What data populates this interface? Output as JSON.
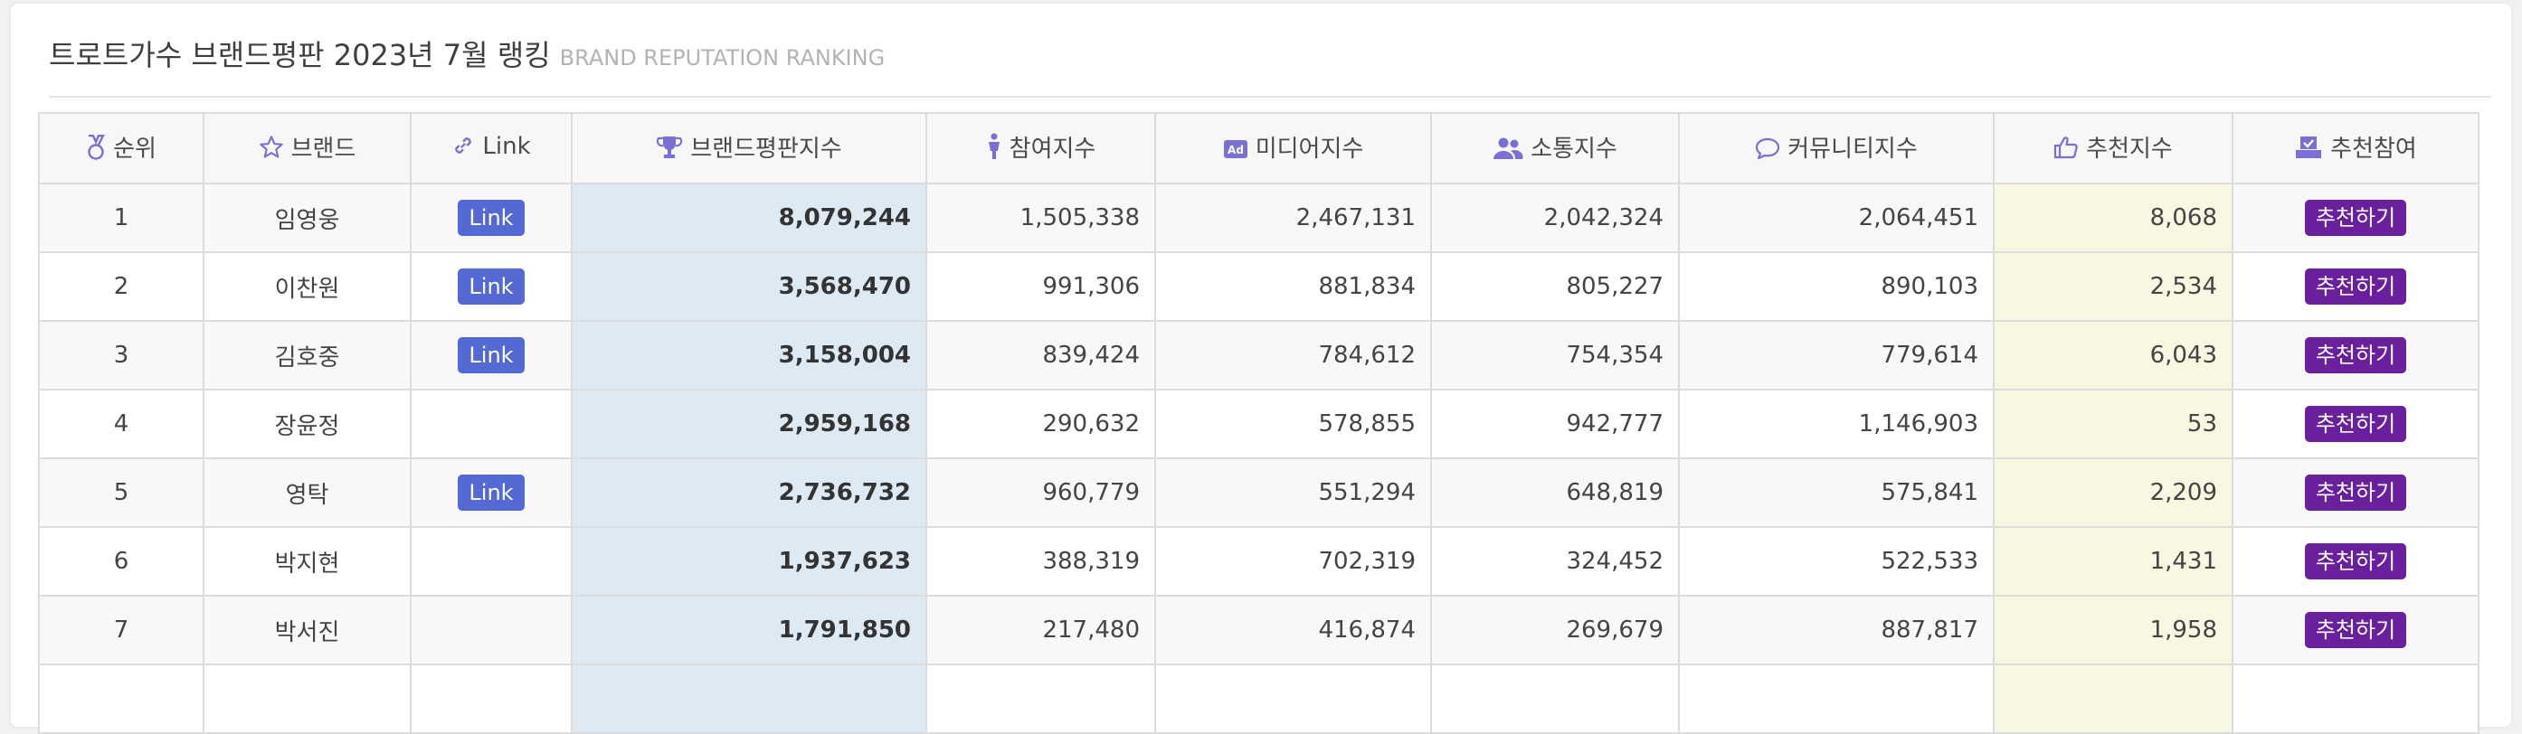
{
  "page": {
    "title": "트로트가수 브랜드평판 2023년 7월 랭킹",
    "subtitle": "BRAND REPUTATION RANKING"
  },
  "colors": {
    "link_button": "#5469d4",
    "recommend_button": "#6a1f9d",
    "brand_score_highlight": "#dde9f3",
    "recommend_score_highlight": "#f9f7e1",
    "icon_color": "#7a6fd6"
  },
  "table": {
    "headers": [
      {
        "label": "순위",
        "icon": "medal-icon"
      },
      {
        "label": "브랜드",
        "icon": "star-icon"
      },
      {
        "label": "Link",
        "icon": "link-icon"
      },
      {
        "label": "브랜드평판지수",
        "icon": "trophy-icon"
      },
      {
        "label": "참여지수",
        "icon": "person-icon"
      },
      {
        "label": "미디어지수",
        "icon": "ad-icon"
      },
      {
        "label": "소통지수",
        "icon": "users-icon"
      },
      {
        "label": "커뮤니티지수",
        "icon": "comment-icon"
      },
      {
        "label": "추천지수",
        "icon": "thumbs-up-icon"
      },
      {
        "label": "추천참여",
        "icon": "vote-icon"
      }
    ],
    "rows": [
      {
        "rank": "1",
        "brand": "임영웅",
        "link": "Link",
        "brand_score": "8,079,244",
        "participation": "1,505,338",
        "media": "2,467,131",
        "communication": "2,042,324",
        "community": "2,064,451",
        "recommend_score": "8,068",
        "recommend_button": "추천하기"
      },
      {
        "rank": "2",
        "brand": "이찬원",
        "link": "Link",
        "brand_score": "3,568,470",
        "participation": "991,306",
        "media": "881,834",
        "communication": "805,227",
        "community": "890,103",
        "recommend_score": "2,534",
        "recommend_button": "추천하기"
      },
      {
        "rank": "3",
        "brand": "김호중",
        "link": "Link",
        "brand_score": "3,158,004",
        "participation": "839,424",
        "media": "784,612",
        "communication": "754,354",
        "community": "779,614",
        "recommend_score": "6,043",
        "recommend_button": "추천하기"
      },
      {
        "rank": "4",
        "brand": "장윤정",
        "link": "",
        "brand_score": "2,959,168",
        "participation": "290,632",
        "media": "578,855",
        "communication": "942,777",
        "community": "1,146,903",
        "recommend_score": "53",
        "recommend_button": "추천하기"
      },
      {
        "rank": "5",
        "brand": "영탁",
        "link": "Link",
        "brand_score": "2,736,732",
        "participation": "960,779",
        "media": "551,294",
        "communication": "648,819",
        "community": "575,841",
        "recommend_score": "2,209",
        "recommend_button": "추천하기"
      },
      {
        "rank": "6",
        "brand": "박지현",
        "link": "",
        "brand_score": "1,937,623",
        "participation": "388,319",
        "media": "702,319",
        "communication": "324,452",
        "community": "522,533",
        "recommend_score": "1,431",
        "recommend_button": "추천하기"
      },
      {
        "rank": "7",
        "brand": "박서진",
        "link": "",
        "brand_score": "1,791,850",
        "participation": "217,480",
        "media": "416,874",
        "communication": "269,679",
        "community": "887,817",
        "recommend_score": "1,958",
        "recommend_button": "추천하기"
      }
    ]
  }
}
